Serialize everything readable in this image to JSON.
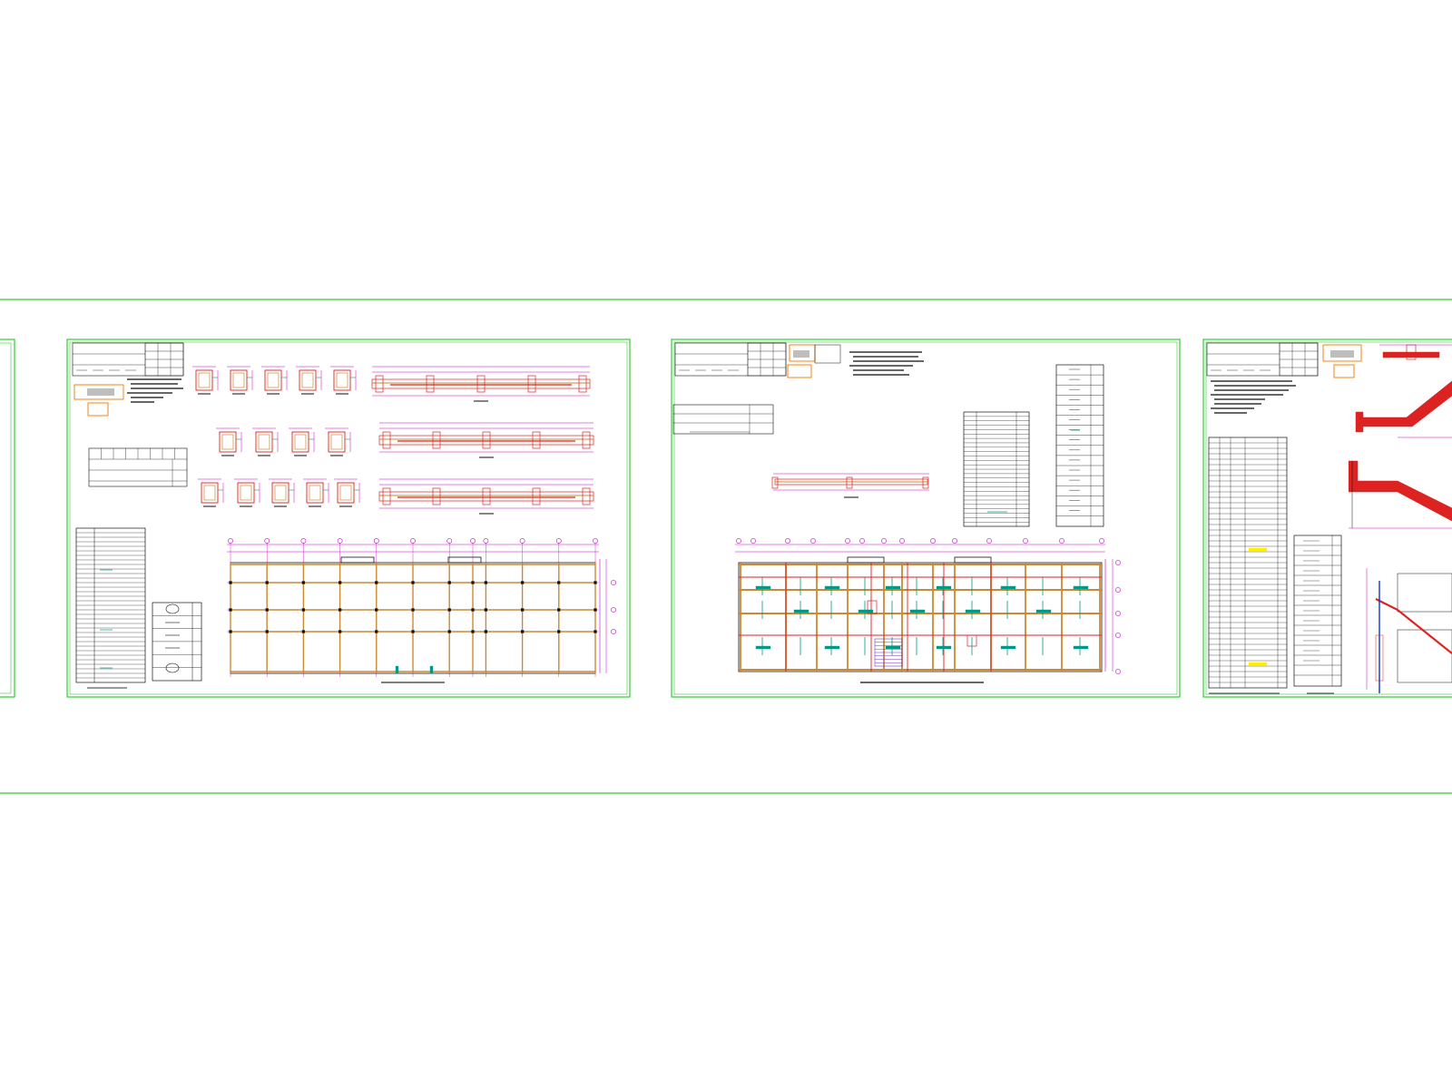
{
  "colors": {
    "background": "#ffffff",
    "frame": "#33cc33",
    "dimension": "#cc00cc",
    "beam": "#cc8833",
    "section": "#dd2222",
    "accent": "#009988",
    "table": "#111111",
    "highlight": "#ffee00",
    "stamp": "#ee7700"
  },
  "sheets": [
    {
      "id": "sheet-partial-left",
      "kind": "partial"
    },
    {
      "id": "sheet-foundation-beams",
      "kind": "foundation-plan",
      "detail_rows": [
        5,
        4,
        5
      ],
      "elevations": 3,
      "axes": 11
    },
    {
      "id": "sheet-slab-reinforcement",
      "kind": "slab-plan",
      "axes": 12,
      "bays": 10
    },
    {
      "id": "sheet-stair-details",
      "kind": "stair",
      "schedule_rows": 30
    }
  ]
}
